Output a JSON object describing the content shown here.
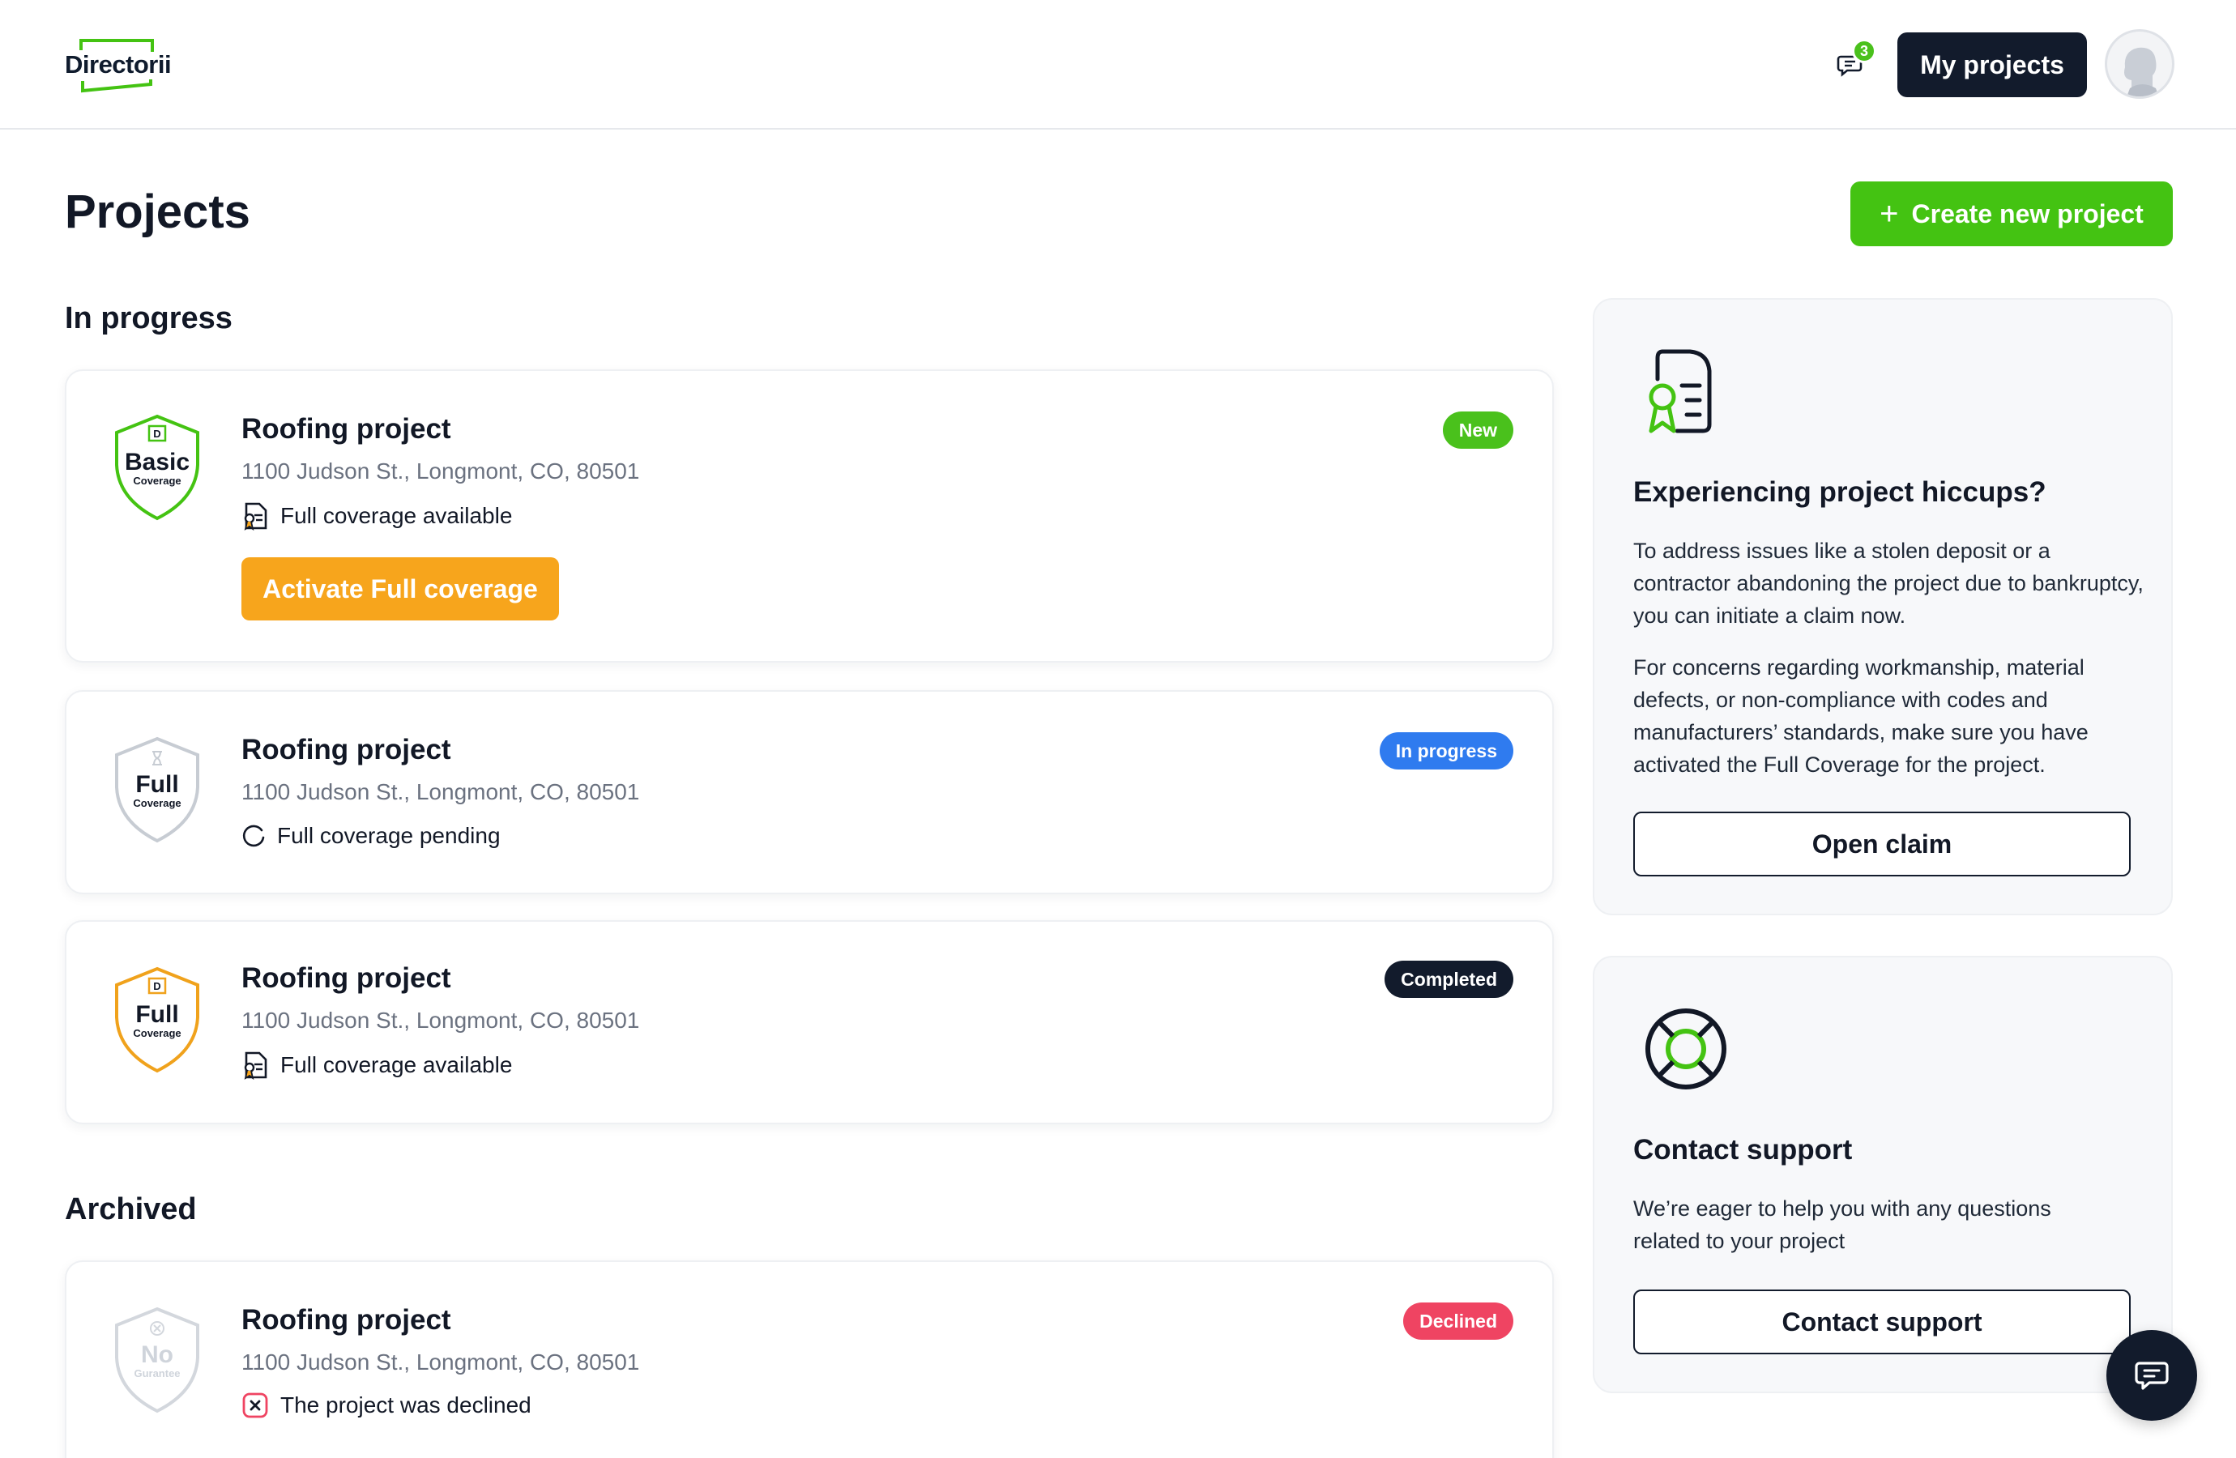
{
  "header": {
    "logo_text": "Directorii",
    "notification_count": "3",
    "my_projects_label": "My projects"
  },
  "page": {
    "title": "Projects",
    "create_label": "Create new project"
  },
  "sections": {
    "in_progress": "In progress",
    "archived": "Archived"
  },
  "projects": [
    {
      "shield": {
        "title": "Basic",
        "subtitle": "Coverage",
        "mark": "D"
      },
      "title": "Roofing project",
      "address": "1100 Judson St., Longmont, CO, 80501",
      "coverage": "Full coverage available",
      "status": "New",
      "action_label": "Activate Full coverage"
    },
    {
      "shield": {
        "title": "Full",
        "subtitle": "Coverage"
      },
      "title": "Roofing project",
      "address": "1100 Judson St., Longmont, CO, 80501",
      "coverage": "Full coverage pending",
      "status": "In progress"
    },
    {
      "shield": {
        "title": "Full",
        "subtitle": "Coverage",
        "mark": "D"
      },
      "title": "Roofing project",
      "address": "1100 Judson St., Longmont, CO, 80501",
      "coverage": "Full coverage available",
      "status": "Completed"
    },
    {
      "shield": {
        "title": "No",
        "subtitle": "Gurantee"
      },
      "title": "Roofing project",
      "address": "1100 Judson St., Longmont, CO, 80501",
      "coverage": "The project was declined",
      "status": "Declined"
    }
  ],
  "hiccups": {
    "title": "Experiencing project hiccups?",
    "p1": "To address issues like a stolen deposit or a contractor abandoning the project due to bankruptcy, you can initiate a claim now.",
    "p2": "For concerns regarding workmanship, material defects, or non-compliance with codes and manufacturers’ standards, make sure you have activated the Full Coverage for the project.",
    "button": "Open claim"
  },
  "support": {
    "title": "Contact support",
    "text": "We’re eager to help you with any questions related to your project",
    "button": "Contact support"
  },
  "colors": {
    "brand_green": "#44c312",
    "dark": "#121b2c",
    "orange": "#f7a51c",
    "blue": "#2f7bef",
    "red": "#ef4462"
  },
  "icons": [
    "chat-icon",
    "user-avatar-icon",
    "plus-icon",
    "certificate-icon",
    "spinner-icon",
    "declined-icon",
    "lifebuoy-icon",
    "shield-badge-icon"
  ]
}
